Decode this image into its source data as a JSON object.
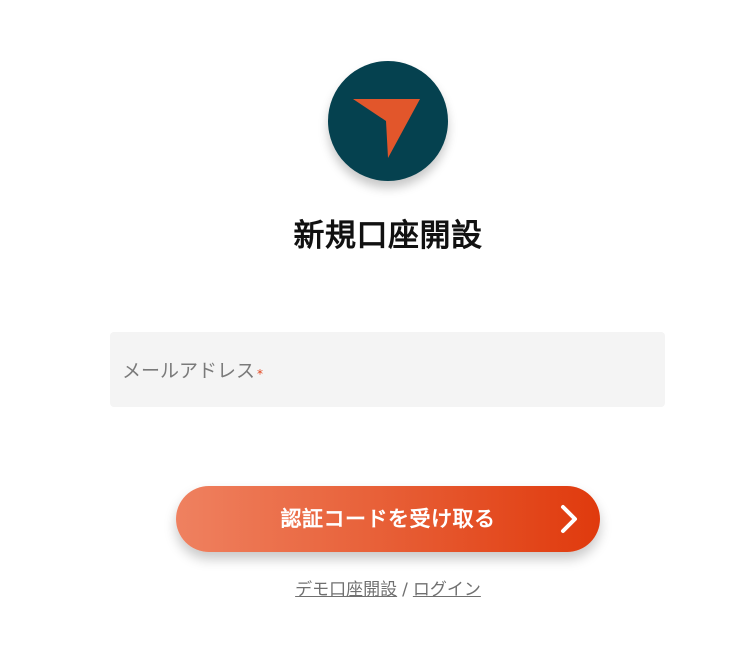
{
  "logo": {
    "icon": "arrow-pointer-icon",
    "bg_color": "#05414f",
    "accent_color": "#e2562b"
  },
  "title": "新規口座開設",
  "email": {
    "label": "メールアドレス",
    "required_mark": "*",
    "value": ""
  },
  "submit": {
    "label": "認証コードを受け取る",
    "icon": "chevron-right-icon"
  },
  "footer": {
    "demo_link": "デモ口座開設",
    "separator": "/",
    "login_link": "ログイン"
  }
}
